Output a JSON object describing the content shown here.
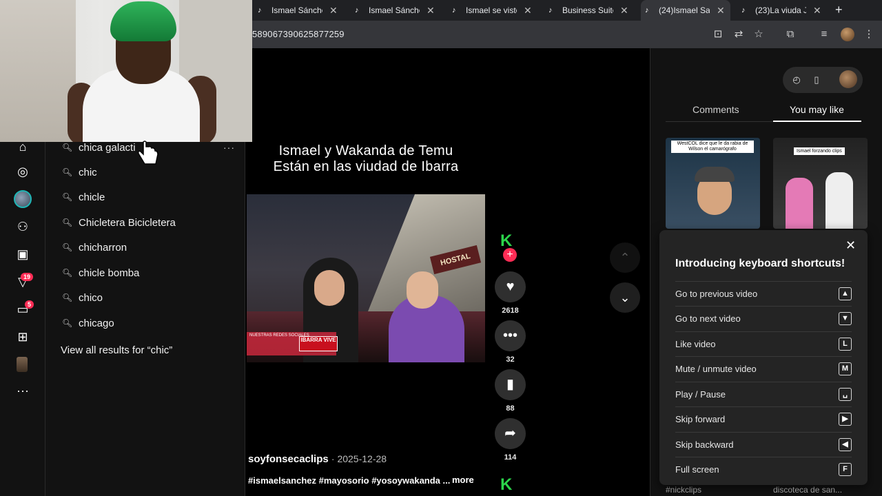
{
  "browser": {
    "tabs": [
      {
        "label": "Ismael Sánche",
        "active": false
      },
      {
        "label": "Ismael Sánche",
        "active": false
      },
      {
        "label": "Ismael se viste",
        "active": false
      },
      {
        "label": "Business Suite",
        "active": false
      },
      {
        "label": "(24)Ismael Sa",
        "active": true
      },
      {
        "label": "(23)La viuda J",
        "active": false
      }
    ],
    "new_tab": "+",
    "url": "589067390625877259"
  },
  "nav_rail": {
    "messages_badge": "5",
    "activity_badge": "19",
    "more": "···"
  },
  "search_suggestions": {
    "items": [
      "chica galacti",
      "chic",
      "chicle",
      "Chicletera Bicicletera",
      "chicharron",
      "chicle bomba",
      "chico",
      "chicago"
    ],
    "view_all": "View all results for “chic”",
    "more_menu": "···"
  },
  "video": {
    "caption_line1": "Ismael y Wakanda de Temu",
    "caption_line2": "Están en las viudad de Ibarra",
    "author": "soyfonsecaclips",
    "date": "· 2025-12-28",
    "hashtags": "#ismaelsanchez #mayosorio #yosoywakanda ...",
    "more": "more",
    "likes": "2618",
    "comments": "32",
    "saves": "88",
    "shares": "114",
    "frame_sign": "HOSTAL",
    "frame_banner": "NUESTRAS REDES SOCIALES",
    "frame_logo": "IBARRA VIVE"
  },
  "right_panel": {
    "tabs": [
      "Comments",
      "You may like"
    ],
    "active_tab": "You may like",
    "thumb1_caption": "WestCOL dice que le da rabia de Wilson el camarógrafo",
    "thumb2_caption": "Ismael forzando clips",
    "bottom_left": "#nickclips",
    "bottom_right": "discoteca de san..."
  },
  "shortcuts": {
    "title": "Introducing keyboard shortcuts!",
    "rows": [
      {
        "label": "Go to previous video",
        "key": "▲"
      },
      {
        "label": "Go to next video",
        "key": "▼"
      },
      {
        "label": "Like video",
        "key": "L"
      },
      {
        "label": "Mute / unmute video",
        "key": "M"
      },
      {
        "label": "Play / Pause",
        "key": "␣"
      },
      {
        "label": "Skip forward",
        "key": "▶"
      },
      {
        "label": "Skip backward",
        "key": "◀"
      },
      {
        "label": "Full screen",
        "key": "F"
      }
    ]
  },
  "colors": {
    "accent_pink": "#fe2c55",
    "kick_green": "#2bd44a"
  }
}
